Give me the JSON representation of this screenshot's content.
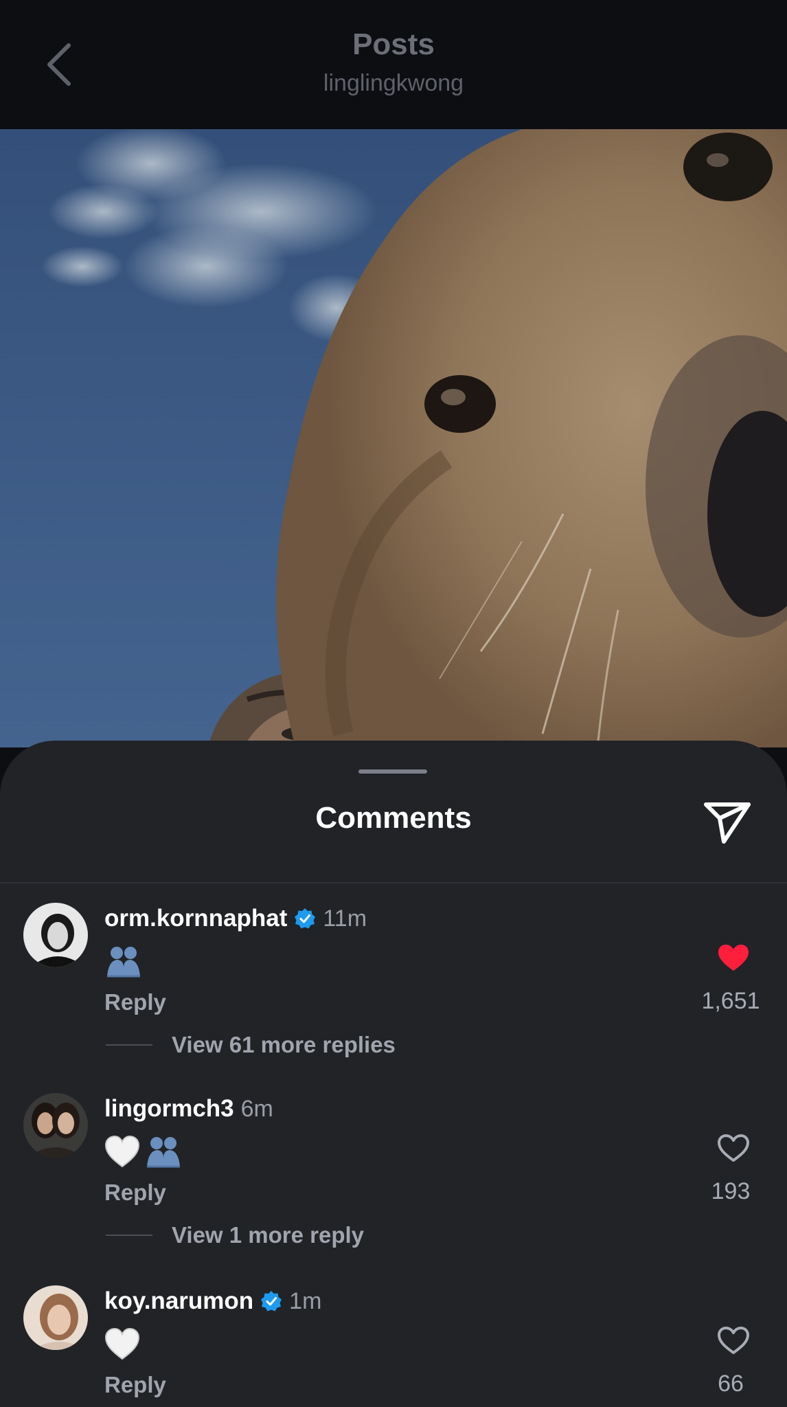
{
  "header": {
    "title": "Posts",
    "subtitle": "linglingkwong",
    "back_icon": "chevron-left-icon"
  },
  "post": {
    "image_description_icon": "photo"
  },
  "comments_sheet": {
    "title": "Comments",
    "share_icon": "paper-plane-icon",
    "comments": [
      {
        "username": "orm.kornnaphat",
        "verified": true,
        "time": "11m",
        "emojis": [
          "blue-hearts-emoji"
        ],
        "reply_label": "Reply",
        "liked": true,
        "like_count": "1,651",
        "view_replies": "View 61 more replies"
      },
      {
        "username": "lingormch3",
        "verified": false,
        "time": "6m",
        "emojis": [
          "white-heart-emoji",
          "blue-hearts-emoji"
        ],
        "reply_label": "Reply",
        "liked": false,
        "like_count": "193",
        "view_replies": "View 1 more reply"
      },
      {
        "username": "koy.narumon",
        "verified": true,
        "time": "1m",
        "emojis": [
          "white-heart-emoji"
        ],
        "reply_label": "Reply",
        "liked": false,
        "like_count": "66"
      }
    ]
  },
  "colors": {
    "background": "#0d0e12",
    "sheet": "#212327",
    "liked_heart": "#ff1f3d",
    "verified": "#1d9bf0",
    "secondary_text": "#a0a4ad"
  }
}
